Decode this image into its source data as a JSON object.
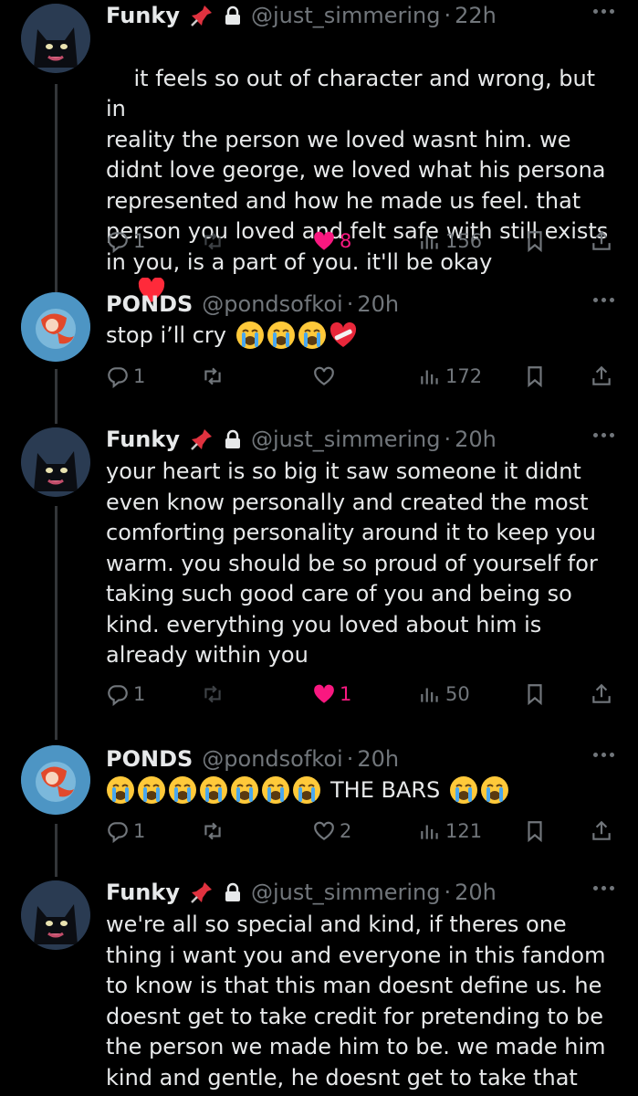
{
  "tweets": [
    {
      "name": "Funky",
      "handle": "@just_simmering",
      "dot": "·",
      "time": "22h",
      "text": "it feels so out of character and wrong, but in\nreality the person we loved wasnt him. we\ndidnt love george, we loved what his persona\nrepresented and how he made us feel. that\nperson you loved and felt safe with still exists\nin you, is a part of you. it'll be okay",
      "replies": "1",
      "likes": "8",
      "views": "156"
    },
    {
      "name": "PONDS",
      "handle": "@pondsofkoi",
      "dot": "·",
      "time": "20h",
      "text": "stop i’ll cry",
      "replies": "1",
      "likes": "",
      "views": "172"
    },
    {
      "name": "Funky",
      "handle": "@just_simmering",
      "dot": "·",
      "time": "20h",
      "text": "your heart is so big it saw someone it didnt\neven know personally and created the most\ncomforting personality around it to keep you\nwarm. you should be so proud of yourself for\ntaking such good care of you and being so\nkind. everything you loved about him is\nalready within you",
      "replies": "1",
      "likes": "1",
      "views": "50"
    },
    {
      "name": "PONDS",
      "handle": "@pondsofkoi",
      "dot": "·",
      "time": "20h",
      "text": "THE BARS",
      "replies": "1",
      "likes": "2",
      "views": "121"
    },
    {
      "name": "Funky",
      "handle": "@just_simmering",
      "dot": "·",
      "time": "20h",
      "text": "we're all so special and kind, if theres one\nthing i want you and everyone in this fandom\nto know is that this man doesnt define us. he\ndoesnt get to take credit for pretending to be\nthe person we made him to be. we made him\nkind and gentle, he doesnt get to take that"
    }
  ],
  "colors": {
    "like": "#f91880",
    "muted": "#71767b",
    "text": "#e7e9ea",
    "heart_emoji": "#ff2a3a"
  }
}
